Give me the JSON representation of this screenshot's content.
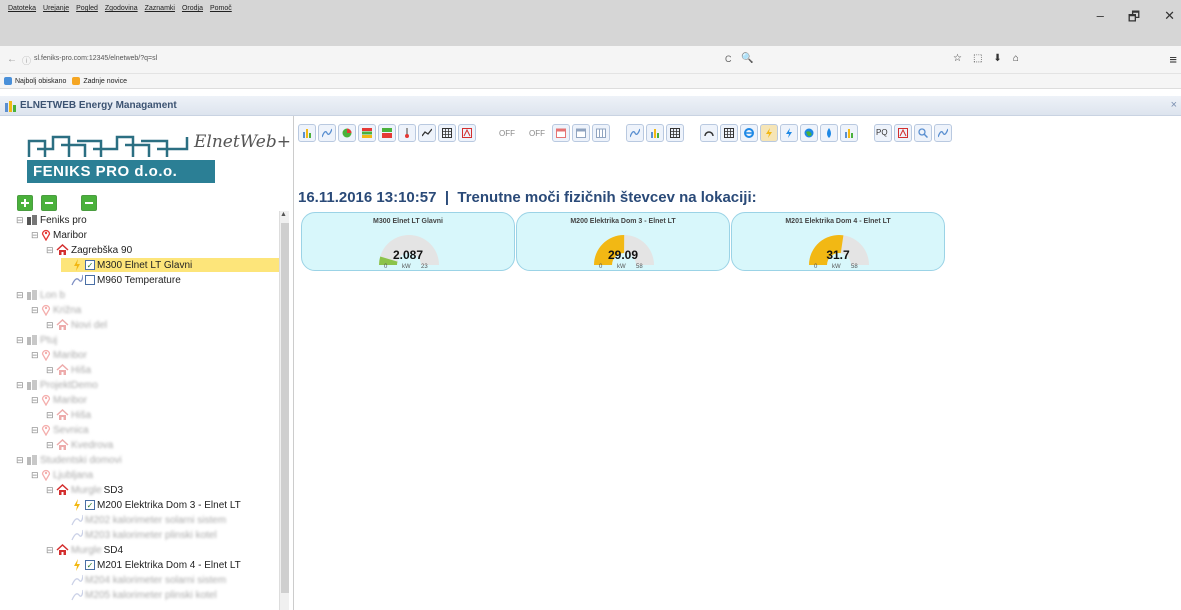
{
  "menu": [
    "Datoteka",
    "Urejanje",
    "Pogled",
    "Zgodovina",
    "Zaznamki",
    "Orodja",
    "Pomoč"
  ],
  "window": {
    "minimize": "–",
    "restore": "🗗",
    "close": "✕"
  },
  "nav": {
    "back": "←",
    "info": "ⓘ",
    "url": "sl.feniks-pro.com:12345/elnetweb/?q=sl",
    "reload": "C",
    "search": "🔍",
    "icons": [
      "☆",
      "⬚",
      "⬇",
      "⌂"
    ],
    "menu": "≡"
  },
  "bookmarks": [
    {
      "label": "Najbolj obiskano",
      "icon": "globe-icon"
    },
    {
      "label": "Zadnje novice",
      "icon": "rss-icon"
    }
  ],
  "app": {
    "title": "ELNETWEB Energy Managament",
    "close": "×"
  },
  "logo": {
    "company": "FENIKS PRO d.o.o.",
    "script": "ElnetWeb+"
  },
  "tree": [
    {
      "text": "Feniks pro",
      "blur": false,
      "icon": "building"
    },
    {
      "text": "Maribor",
      "blur": false,
      "icon": "pin"
    },
    {
      "text": "Zagrebška 90",
      "blur": false,
      "icon": "house"
    },
    {
      "text": "M300 Elnet LT Glavni",
      "blur": false,
      "icon": "meter",
      "checked": true,
      "selected": true
    },
    {
      "text": "M960 Temperature",
      "blur": false,
      "icon": "temp",
      "checked": false
    },
    {
      "text": "Lon b",
      "blur": true,
      "icon": "building"
    },
    {
      "text": "Križna",
      "blur": true,
      "icon": "pin"
    },
    {
      "text": "Novi del",
      "blur": true,
      "icon": "house"
    },
    {
      "text": "Ptuj",
      "blur": true,
      "icon": "building"
    },
    {
      "text": "Maribor",
      "blur": true,
      "icon": "pin"
    },
    {
      "text": "Hiša",
      "blur": true,
      "icon": "house"
    },
    {
      "text": "ProjektDemo",
      "blur": true,
      "icon": "building"
    },
    {
      "text": "Maribor",
      "blur": true,
      "icon": "pin"
    },
    {
      "text": "Hiša",
      "blur": true,
      "icon": "house"
    },
    {
      "text": "Sevnica",
      "blur": true,
      "icon": "pin"
    },
    {
      "text": "Kvedrova",
      "blur": true,
      "icon": "house"
    },
    {
      "text": "Studentski domovi",
      "blur": true,
      "icon": "building"
    },
    {
      "text": "Ljubljana",
      "blur": true,
      "icon": "pin"
    },
    {
      "text": "SD3",
      "blur": false,
      "prefix": "Murgle",
      "icon": "house"
    },
    {
      "text": "M200 Elektrika Dom 3 - Elnet LT",
      "blur": false,
      "icon": "meter",
      "checked": true
    },
    {
      "text": "M202 kalorimeter solarni sistem",
      "blur": true,
      "icon": "temp"
    },
    {
      "text": "M203 kalorimeter plinski kotel",
      "blur": true,
      "icon": "temp"
    },
    {
      "text": "SD4",
      "blur": false,
      "prefix": "Murgle",
      "icon": "house"
    },
    {
      "text": "M201 Elektrika Dom 4 - Elnet LT",
      "blur": false,
      "icon": "meter",
      "checked": true
    },
    {
      "text": "M204 kalorimeter solarni sistem",
      "blur": true,
      "icon": "temp"
    },
    {
      "text": "M205 kalorimeter plinski kotel",
      "blur": true,
      "icon": "temp"
    }
  ],
  "toolbar": {
    "off1": "OFF",
    "off2": "OFF",
    "pq": "PQ"
  },
  "page": {
    "datetime": "16.11.2016 13:10:57",
    "separator": "|",
    "heading": "Trenutne moči fizičnih števcev na lokaciji:"
  },
  "gauges": [
    {
      "title": "M300 Elnet LT Glavni",
      "value": "2.087",
      "min": "0",
      "unit": "kW",
      "max": "23",
      "fraction": 0.091,
      "color": "#8bc34a"
    },
    {
      "title": "M200 Elektrika Dom 3 - Elnet LT",
      "value": "29.09",
      "min": "0",
      "unit": "kW",
      "max": "58",
      "fraction": 0.502,
      "color": "#f2b814"
    },
    {
      "title": "M201 Elektrika Dom 4 - Elnet LT",
      "value": "31.7",
      "min": "0",
      "unit": "kW",
      "max": "58",
      "fraction": 0.547,
      "color": "#f2b814"
    }
  ]
}
